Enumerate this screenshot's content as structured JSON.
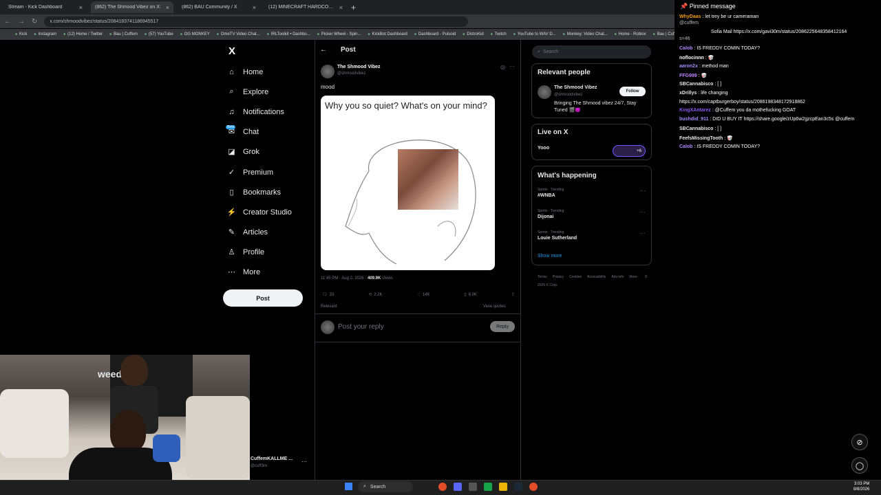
{
  "browser": {
    "tabs": [
      {
        "label": "Stream - Kick Dashboard",
        "close": "×"
      },
      {
        "label": "(862) The Shmood Vibez on X:",
        "close": "×"
      },
      {
        "label": "(862) BAU Community / X",
        "close": "×"
      },
      {
        "label": "(12) MINECRAFT HARDCORE A...",
        "close": "×"
      }
    ],
    "new_tab": "+",
    "url": "x.com/shmoodvibez/status/2084183741186945517",
    "bookmarks": [
      "Kick",
      "Instagram",
      "(12) Home / Twitter",
      "Bau | Cuffem",
      "(57) YouTube",
      "OG MONKEY",
      "OmeTV Video Chat...",
      "IRLToolkit • Dashbo...",
      "Picker Wheel - Spin...",
      "KickBot Dashboard",
      "Dashboard - Pulsoid",
      "DistroKid",
      "Twitch",
      "YouTube to WAV D...",
      "Monkey: Video Chat...",
      "Home - Roblox",
      "Bau | Cuffem"
    ]
  },
  "nav": {
    "logo": "X",
    "items": [
      {
        "label": "Home",
        "icon": "⌂"
      },
      {
        "label": "Explore",
        "icon": "⌕"
      },
      {
        "label": "Notifications",
        "icon": "♫"
      },
      {
        "label": "Chat",
        "icon": "✉"
      },
      {
        "label": "Grok",
        "icon": "◪"
      },
      {
        "label": "Premium",
        "icon": "✓"
      },
      {
        "label": "Bookmarks",
        "icon": "▯"
      },
      {
        "label": "Creator Studio",
        "icon": "⚡"
      },
      {
        "label": "Articles",
        "icon": "✎"
      },
      {
        "label": "Profile",
        "icon": "♙"
      },
      {
        "label": "More",
        "icon": "⋯"
      }
    ],
    "chat_badge": "Beta",
    "post_button": "Post"
  },
  "post": {
    "header_title": "Post",
    "back_icon": "←",
    "author_name": "The Shmood Vibez",
    "author_handle": "@shmoodvibez",
    "text": "mood",
    "meme_text": "Why you so quiet? What's on your mind?",
    "timestamp": "11:45 PM · Aug 2, 2026 ·",
    "views_count": "409.9K",
    "views_label": "Views",
    "replies": "33",
    "reposts": "2.2K",
    "likes": "14K",
    "bookmarks": "6.0K",
    "relevant": "Relevant",
    "view_quotes": "View quotes",
    "reply_placeholder": "Post your reply",
    "reply_button": "Reply"
  },
  "sidebar": {
    "search_placeholder": "Search",
    "relevant_title": "Relevant people",
    "person_name": "The Shmood Vibez",
    "person_handle": "@shmoodvibez",
    "person_bio": "Bringing The Shmood vibez 24/7, Stay Tuned 🎬😈",
    "follow": "Follow",
    "live_title": "Live on X",
    "live_item": "Yooo",
    "live_count": "+6",
    "happening_title": "What's happening",
    "trends": [
      {
        "category": "Sports · Trending",
        "name": "#WNBA"
      },
      {
        "category": "Sports · Trending",
        "name": "Dijonai"
      },
      {
        "category": "Sports · Trending",
        "name": "Louie Sutherland"
      }
    ],
    "show_more": "Show more",
    "footer": [
      "Terms",
      "Privacy",
      "Cookies",
      "Accessibility",
      "Ads info",
      "More ·",
      "© 2026 X Corp."
    ]
  },
  "chat": {
    "pinned_title": "Pinned message",
    "pinned_user": "WhyDaas",
    "pinned_text": "let trey be ur cameraman",
    "pinned_handle": "@cuffem",
    "notice": "Sofia Mail https://x.com/gavi30m/status/2086225648358412164",
    "notice_tail": "s=46",
    "lines": [
      {
        "user": "Calob",
        "text": "IS FREDDY COMIN TODAY?",
        "color": "#b28dff"
      },
      {
        "user": "noflocinnn",
        "text": "🥡",
        "color": "#ffffff"
      },
      {
        "user": "aaron2x",
        "text": "method man",
        "color": "#a78bfa"
      },
      {
        "user": "FFG999",
        "text": "🥡",
        "color": "#c084fc"
      },
      {
        "user": "SBCannabisco",
        "text": "[ ]",
        "color": "#e7e9ea"
      },
      {
        "user": "xDrillys",
        "text": "life changing",
        "color": "#e7e9ea"
      },
      {
        "user": "",
        "text": "https://x.com/captburgerboy/status/2086198348172918862",
        "color": "#e7e9ea"
      },
      {
        "user": "KingXAntarez",
        "text": "@Cuffem you da mothefucking GOAT",
        "color": "#8b5cf6"
      },
      {
        "user": "bushdid_911",
        "text": "DID U BUY IT https://share.google/zUp6w2gzcpEan3c5s @cuffem",
        "color": "#a78bfa"
      },
      {
        "user": "SBCannabisco",
        "text": "[ ]",
        "color": "#e7e9ea"
      },
      {
        "user": "FeefsMissingTooth",
        "text": "🥡",
        "color": "#e7e9ea"
      },
      {
        "user": "Calob",
        "text": "IS FREDDY COMIN TODAY?",
        "color": "#b28dff"
      }
    ]
  },
  "webcam": {
    "sign": "weed",
    "account_name": "CuffemKALLME ...",
    "account_handle": "@cuff3m",
    "more": "···"
  },
  "taskbar": {
    "search": "Search",
    "time": "3:03 PM",
    "date": "8/8/2026"
  }
}
